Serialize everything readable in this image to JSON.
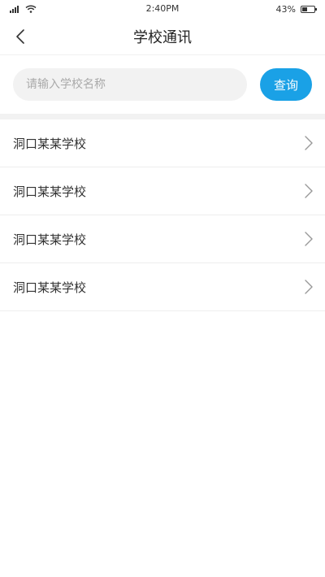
{
  "status_bar": {
    "time": "2:40PM",
    "battery_percent": "43%",
    "battery_level": 0.43
  },
  "header": {
    "title": "学校通讯"
  },
  "search": {
    "placeholder": "请输入学校名称",
    "button_label": "查询"
  },
  "schools": [
    {
      "name": "洞口某某学校"
    },
    {
      "name": "洞口某某学校"
    },
    {
      "name": "洞口某某学校"
    },
    {
      "name": "洞口某某学校"
    }
  ],
  "colors": {
    "accent": "#1aa1e6",
    "input_bg": "#f2f2f2",
    "divider": "#eeeeee"
  },
  "icons": {
    "back": "chevron-left-icon",
    "row": "chevron-right-icon",
    "signal": "signal-icon",
    "wifi": "wifi-icon",
    "battery": "battery-icon"
  }
}
